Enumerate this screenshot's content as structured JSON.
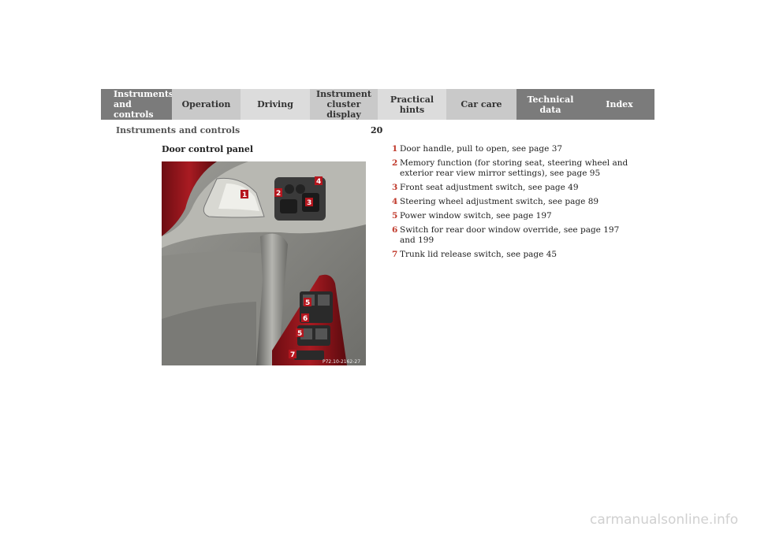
{
  "tabs": [
    {
      "label": "Instruments\nand controls"
    },
    {
      "label": "Operation"
    },
    {
      "label": "Driving"
    },
    {
      "label": "Instrument\ncluster display"
    },
    {
      "label": "Practical hints"
    },
    {
      "label": "Car care"
    },
    {
      "label": "Technical\ndata"
    },
    {
      "label": "Index"
    }
  ],
  "header": {
    "section": "Instruments and controls",
    "page": "20"
  },
  "figure": {
    "caption": "Door control panel",
    "code": "P72.10-2162-27",
    "callouts": [
      "1",
      "2",
      "3",
      "4",
      "5",
      "6",
      "5",
      "7"
    ]
  },
  "items": [
    {
      "num": "1",
      "text": "Door handle, pull to open, see page 37"
    },
    {
      "num": "2",
      "text": "Memory function (for storing seat, steering wheel and exterior rear view mirror settings), see page 95"
    },
    {
      "num": "3",
      "text": "Front seat adjustment switch, see page 49"
    },
    {
      "num": "4",
      "text": "Steering wheel adjustment switch, see page 89"
    },
    {
      "num": "5",
      "text": "Power window switch, see page 197"
    },
    {
      "num": "6",
      "text": "Switch for rear door window override, see page 197 and 199"
    },
    {
      "num": "7",
      "text": "Trunk lid release switch, see page 45"
    }
  ],
  "footer": "carmanualsonline.info"
}
